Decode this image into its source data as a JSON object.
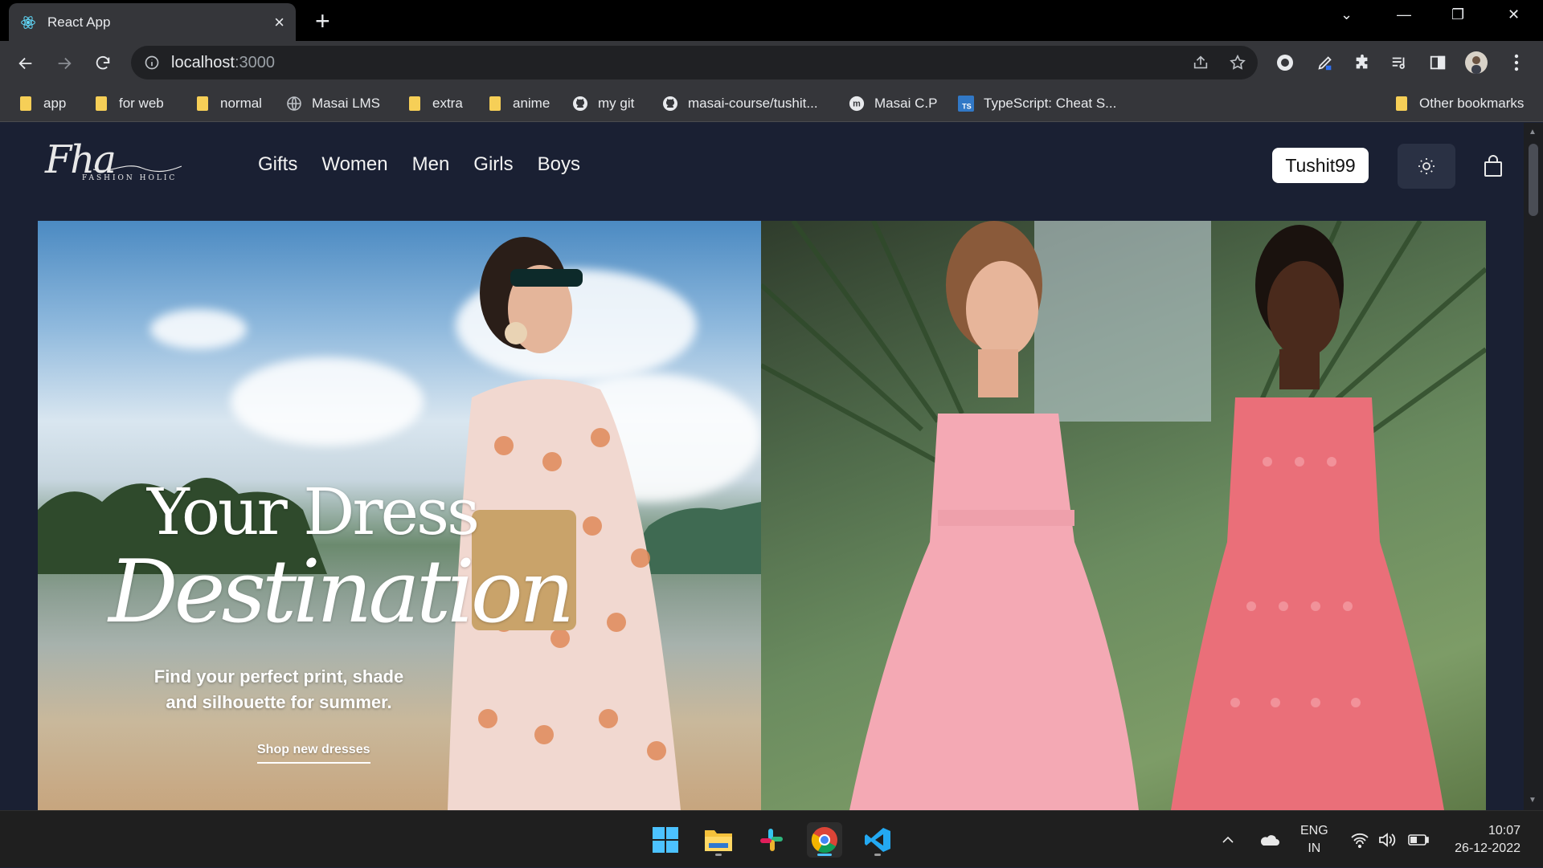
{
  "browser": {
    "tab_title": "React App",
    "url_host": "localhost",
    "url_port": ":3000",
    "bookmarks": [
      {
        "label": "app",
        "icon": "folder-icon"
      },
      {
        "label": "for web",
        "icon": "folder-icon"
      },
      {
        "label": "normal",
        "icon": "folder-icon"
      },
      {
        "label": "Masai LMS",
        "icon": "globe-icon"
      },
      {
        "label": "extra",
        "icon": "folder-icon"
      },
      {
        "label": "anime",
        "icon": "folder-icon"
      },
      {
        "label": "my git",
        "icon": "github-icon"
      },
      {
        "label": "masai-course/tushit...",
        "icon": "github-icon"
      },
      {
        "label": "Masai C.P",
        "icon": "m-icon"
      },
      {
        "label": "TypeScript: Cheat S...",
        "icon": "ts-icon"
      }
    ],
    "other_bookmarks": "Other bookmarks"
  },
  "site": {
    "logo_script": "Fha",
    "logo_sub": "FASHION HOLIC",
    "nav": [
      "Gifts",
      "Women",
      "Men",
      "Girls",
      "Boys"
    ],
    "user_button": "Tushit99",
    "hero": {
      "headline_line1": "Your Dress",
      "headline_line2": "Destination",
      "subtitle_line1": "Find your perfect print, shade",
      "subtitle_line2": "and silhouette for summer.",
      "cta": "Shop new dresses"
    }
  },
  "taskbar": {
    "lang_line1": "ENG",
    "lang_line2": "IN",
    "time": "10:07",
    "date": "26-12-2022"
  }
}
